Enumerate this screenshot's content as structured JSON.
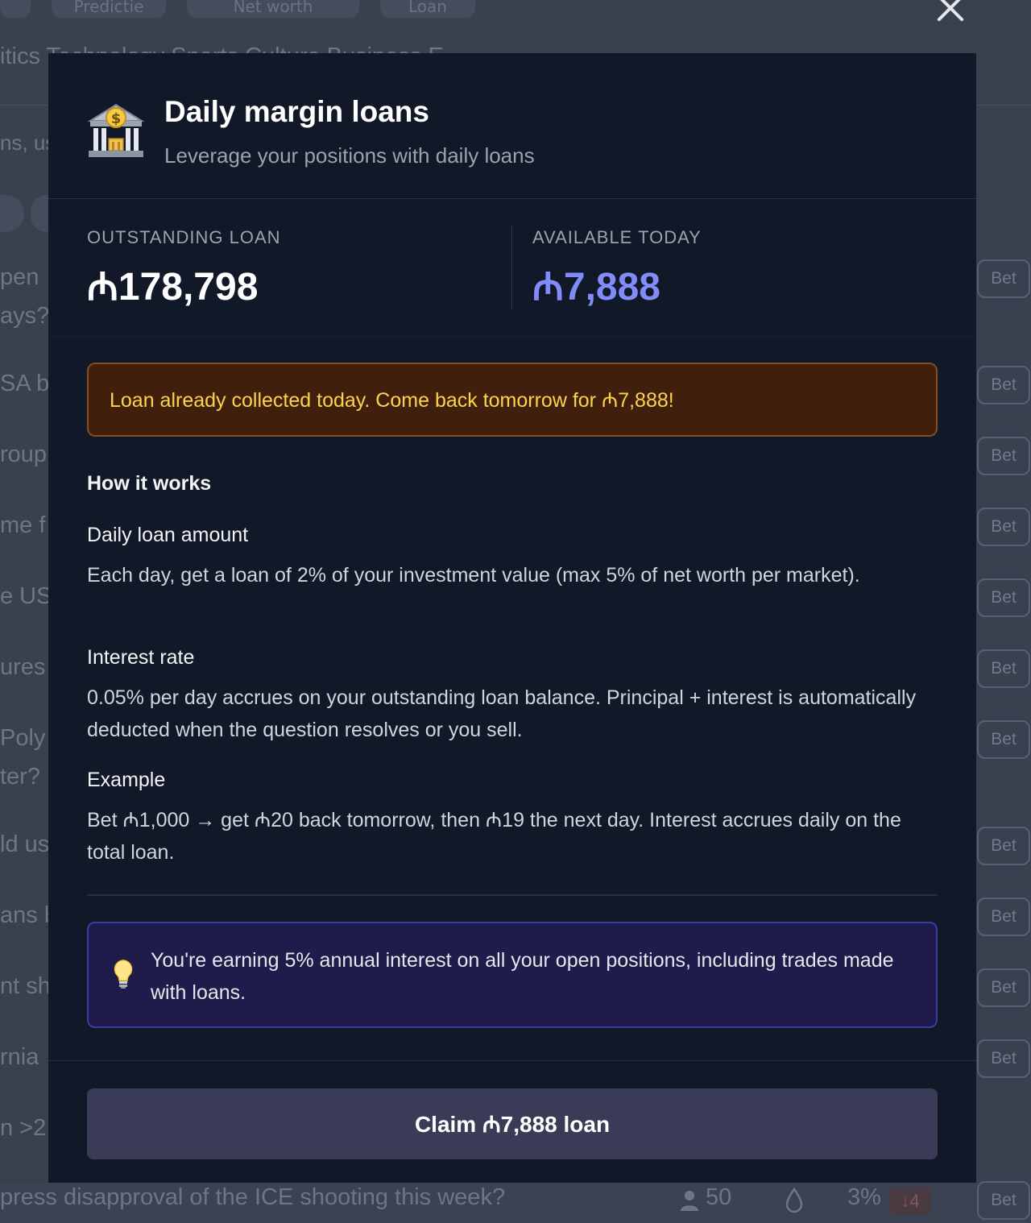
{
  "background": {
    "top_pills": [
      "Predictie",
      "Net worth",
      "Loan"
    ],
    "category_tabs": "itics    Technology    Sports    Culture    Business    E",
    "search_fragment": "ns, us",
    "row_fragments": [
      "pen",
      "ays?",
      "SA b",
      "roup",
      "me f",
      "e US",
      "ures",
      "Poly",
      "ter?",
      "ld us",
      "ans b",
      "nt sh",
      "rnia",
      "n >2"
    ],
    "bet_label": "Bet",
    "bottom_question": "press disapproval of the ICE shooting this week?",
    "bottom_traders": "50",
    "bottom_prob": "3%",
    "bottom_change": "4"
  },
  "modal": {
    "icon": "bank-icon",
    "title": "Daily margin loans",
    "subtitle": "Leverage your positions with daily loans",
    "outstanding_label": "OUTSTANDING LOAN",
    "outstanding_value": "₼178,798",
    "available_label": "AVAILABLE TODAY",
    "available_value": "₼7,888",
    "warning": "Loan already collected today. Come back tomorrow for ₼7,888!",
    "how_heading": "How it works",
    "daily_heading": "Daily loan amount",
    "daily_text": "Each day, get a loan of 2% of your investment value (max 5% of net worth per market).",
    "interest_heading": "Interest rate",
    "interest_text": "0.05% per day accrues on your outstanding loan balance. Principal + interest is automatically deducted when the question resolves or you sell.",
    "example_heading": "Example",
    "example_text": "Bet ₼1,000 → get ₼20 back tomorrow, then ₼19 the next day. Interest accrues daily on the total loan.",
    "info_icon": "lightbulb-icon",
    "info_text": "You're earning 5% annual interest on all your open positions, including trades made with loans.",
    "claim_label": "Claim ₼7,888 loan"
  },
  "colors": {
    "available_value": "#818cf8",
    "warning_text": "#fcd34d",
    "warning_bg": "#40200c",
    "info_bg": "#1f1b4b"
  }
}
